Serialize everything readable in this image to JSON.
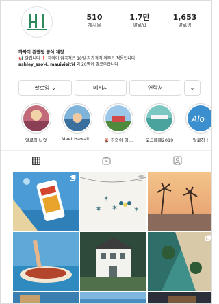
{
  "profile": {
    "logo_text": "HI",
    "stats": [
      {
        "value": "510",
        "label": "게시물"
      },
      {
        "value": "1.7만",
        "label": "팔로워"
      },
      {
        "value": "1,653",
        "label": "팔로잉"
      }
    ],
    "bio": {
      "name": "하와이 관광청 공식 계정",
      "line1": "알립니다 ❗ 하와이 입국객은 10일 자가격리 의무가 적용됩니다.",
      "followed_by_users": "ashley_sso님, mauivisit님",
      "followed_by_rest": "외 20명이 팔로우합니다"
    }
  },
  "buttons": {
    "follow": "팔로잉 ⌄",
    "message": "메시지",
    "contact": "연락처",
    "more": "⌄"
  },
  "highlights": [
    {
      "label": "알로하 나잇"
    },
    {
      "label": "Meet Hawaii..."
    },
    {
      "label": "🌋 하와이 아..."
    },
    {
      "label": "오크페페2019"
    },
    {
      "label": "알로하 !"
    }
  ],
  "tabs": [
    {
      "name": "grid",
      "icon": "grid-icon"
    },
    {
      "name": "igtv",
      "icon": "tv-icon"
    },
    {
      "name": "tagged",
      "icon": "tag-person-icon"
    }
  ],
  "colors": {
    "text": "#262626",
    "border": "#dbdbdb",
    "logo_green": "#2e8a5b"
  }
}
